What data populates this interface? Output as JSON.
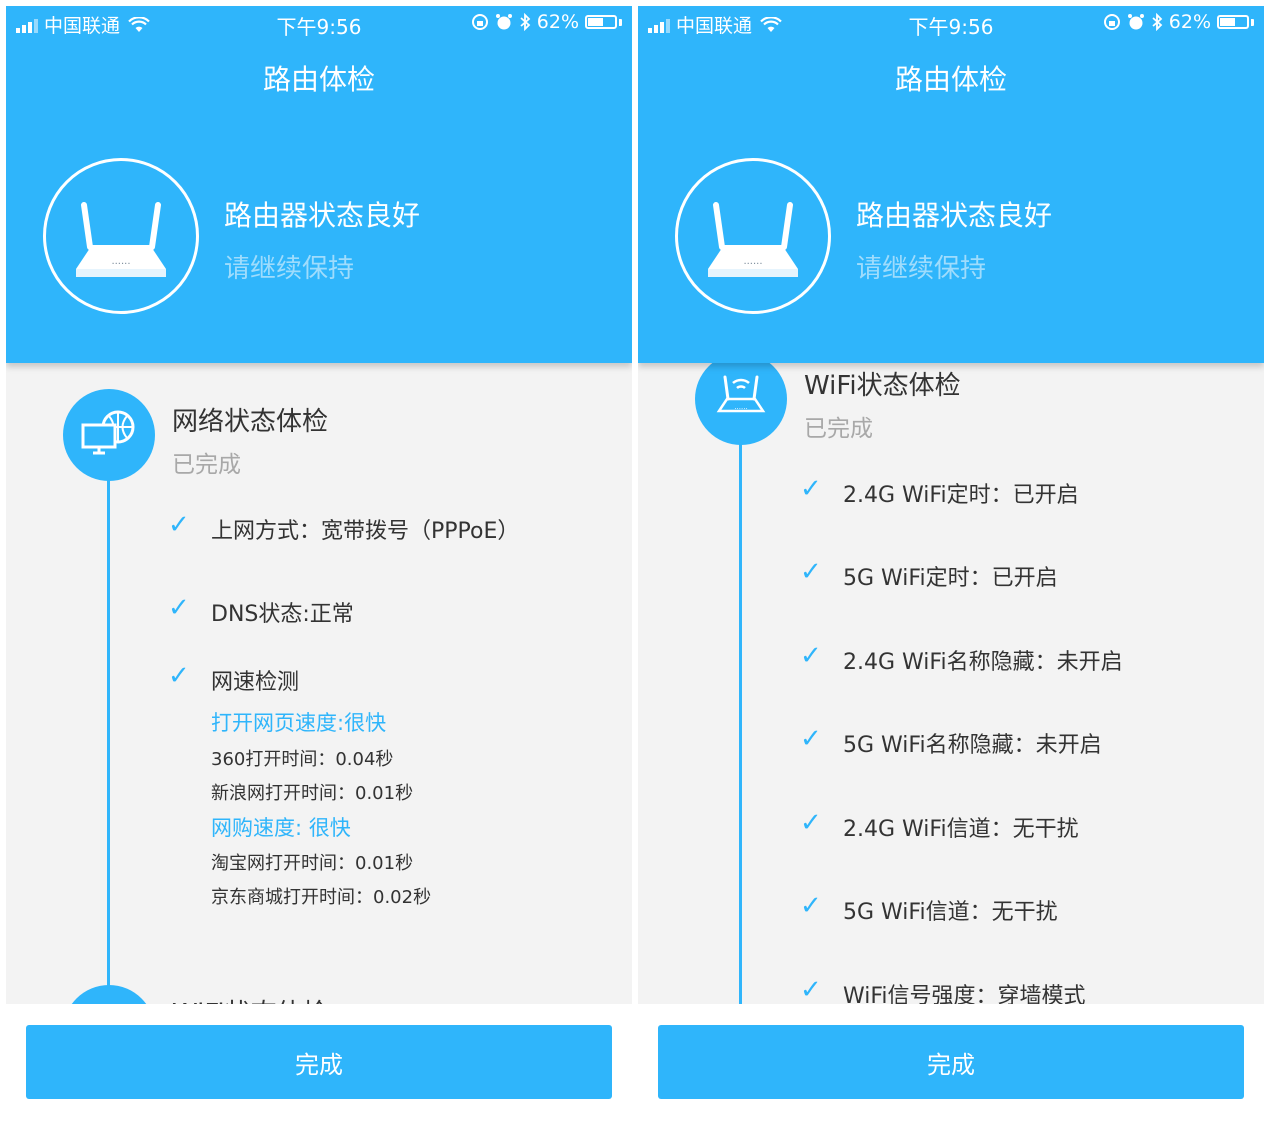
{
  "statusbar": {
    "carrier": "中国联通",
    "time": "下午9:56",
    "battery": "62%",
    "battery_level": 0.62
  },
  "header": {
    "title": "路由体检",
    "status_main": "路由器状态良好",
    "status_sub": "请继续保持"
  },
  "left": {
    "network": {
      "title": "网络状态体检",
      "status": "已完成",
      "items": [
        "上网方式：宽带拨号（PPPoE）",
        "DNS状态:正常",
        "网速检测"
      ],
      "speed": {
        "web_label": "打开网页速度:很快",
        "web_360": "360打开时间：0.04秒",
        "web_sina": "新浪网打开时间：0.01秒",
        "shop_label": "网购速度: 很快",
        "shop_taobao": "淘宝网打开时间：0.01秒",
        "shop_jd": "京东商城打开时间：0.02秒"
      }
    },
    "next_partial_title": "WiFi状态体检"
  },
  "right": {
    "wifi": {
      "title": "WiFi状态体检",
      "status": "已完成",
      "items": [
        "2.4G WiFi定时：已开启",
        "5G WiFi定时：已开启",
        "2.4G WiFi名称隐藏：未开启",
        "5G WiFi名称隐藏：未开启",
        "2.4G WiFi信道：无干扰",
        "5G WiFi信道：无干扰",
        "WiFi信号强度：穿墙模式"
      ]
    }
  },
  "footer": {
    "done_label": "完成"
  },
  "colors": {
    "primary": "#2fb5fb",
    "background": "#f3f3f3",
    "muted": "#a8a8a8"
  },
  "icons": {
    "check": "check-icon",
    "router": "router-icon",
    "network": "network-globe-icon",
    "wifi_router": "wifi-router-icon"
  }
}
